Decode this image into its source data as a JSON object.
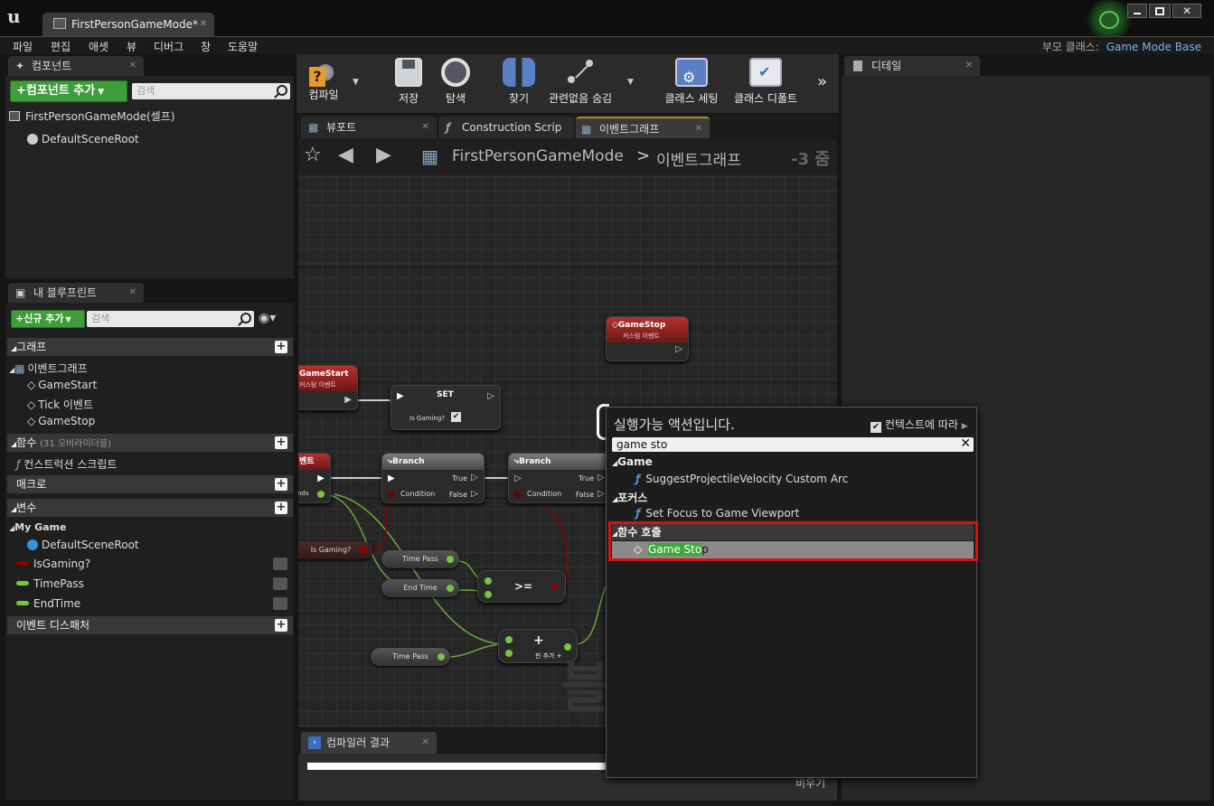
{
  "title_bar": {
    "tab_title": "FirstPersonGameMode*"
  },
  "menu": {
    "items": [
      "파일",
      "편집",
      "애셋",
      "뷰",
      "디버그",
      "창",
      "도움말"
    ],
    "parent_class_label": "부모 클래스:",
    "parent_class_value": "Game Mode Base"
  },
  "components_panel": {
    "tab": "컴포넌트",
    "add_button": "+컴포넌트 추가",
    "search_placeholder": "검색",
    "root": "FirstPersonGameMode(셀프)",
    "child": "DefaultSceneRoot"
  },
  "blueprint_panel": {
    "tab": "내 블루프린트",
    "new_button": "+신규 추가",
    "search_placeholder": "검색",
    "graphs_label": "그래프",
    "event_graph": "이벤트그래프",
    "events": [
      "GameStart",
      "Tick 이벤트",
      "GameStop"
    ],
    "functions_label": "함수",
    "functions_override": "(31 오버라이더블)",
    "construction_script": "컨스트럭션 스크립트",
    "macros_label": "매크로",
    "variables_label": "변수",
    "category": "My Game",
    "variables": [
      "DefaultSceneRoot",
      "IsGaming?",
      "TimePass",
      "EndTime"
    ],
    "dispatchers_label": "이벤트 디스패처"
  },
  "toolbar": {
    "compile": "컴파일",
    "save": "저장",
    "browse": "탐색",
    "find": "찾기",
    "hide_unrelated": "관련없음 숨김",
    "class_settings": "클래스 세팅",
    "class_defaults": "클래스 디폴트"
  },
  "editor_tabs": {
    "viewport": "뷰포트",
    "construction": "Construction Scrip",
    "event_graph": "이벤트그래프"
  },
  "breadcrumb": {
    "root": "FirstPersonGameMode",
    "sep": ">",
    "current": "이벤트그래프",
    "zoom": "-3 줌"
  },
  "details": {
    "tab": "디테일"
  },
  "compiler": {
    "tab": "컴파일러 결과",
    "clear": "비우기"
  },
  "graph_nodes": {
    "gamestop": "GameStop",
    "gamestop_sub": "커스텀 이벤트",
    "gamestart": "GameStart",
    "gamestart_sub": "커스텀 이벤트",
    "set": "SET",
    "is_gaming_q": "Is Gaming?",
    "branch": "Branch",
    "true_label": "True",
    "false_label": "False",
    "condition": "Condition",
    "time_pass": "Time Pass",
    "end_time": "End Time",
    "gte": ">=",
    "plus": "+",
    "add_pin": "핀 추가",
    "left_partial": "벤트",
    "ends": "nds",
    "is_gaming": "Is Gaming?"
  },
  "action_menu": {
    "title": "실행가능 액션입니다.",
    "context_label": "컨텍스트에 따라",
    "search_value": "game sto",
    "cat_game": "Game",
    "item_suggest": "SuggestProjectileVelocity Custom Arc",
    "cat_focus": "포커스",
    "item_focus": "Set Focus to Game Viewport",
    "cat_call": "함수 호출",
    "item_highlight": "Game Sto",
    "item_rest": "p"
  },
  "colors": {
    "accent_green": "#3f9d3a",
    "selection_red": "#d41414",
    "node_red": "#b5302d"
  }
}
